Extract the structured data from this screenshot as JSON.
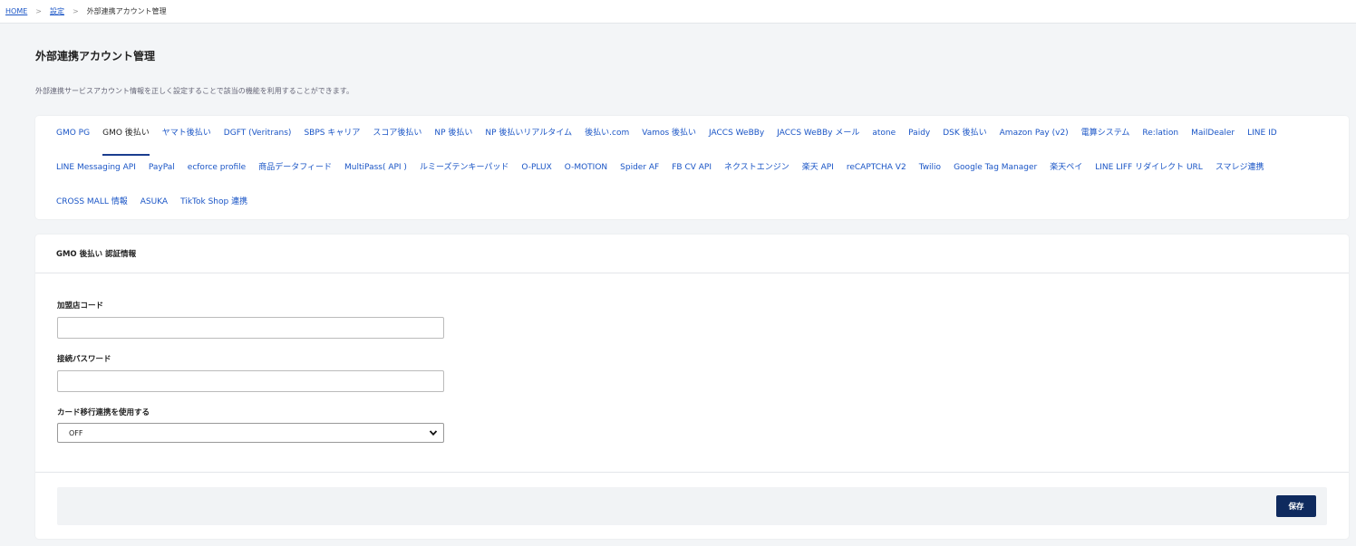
{
  "breadcrumb": {
    "home": "HOME",
    "settings": "設定",
    "current": "外部連携アカウント管理",
    "separator": ">"
  },
  "page": {
    "title": "外部連携アカウント管理",
    "description": "外部連携サービスアカウント情報を正しく設定することで該当の機能を利用することができます。"
  },
  "tabs": {
    "row1": [
      "GMO PG",
      "GMO 後払い",
      "ヤマト後払い",
      "DGFT (Veritrans)",
      "SBPS キャリア",
      "スコア後払い",
      "NP 後払い",
      "NP 後払いリアルタイム",
      "後払い.com",
      "Vamos 後払い",
      "JACCS WeBBy",
      "JACCS WeBBy メール",
      "atone",
      "Paidy",
      "DSK 後払い",
      "Amazon Pay (v2)",
      "電算システム",
      "Re:lation",
      "MailDealer",
      "LINE ID"
    ],
    "row2": [
      "LINE Messaging API",
      "PayPal",
      "ecforce profile",
      "商品データフィード",
      "MultiPass( API )",
      "ルミーズテンキーパッド",
      "O-PLUX",
      "O-MOTION",
      "Spider AF",
      "FB CV API",
      "ネクストエンジン",
      "楽天 API",
      "reCAPTCHA V2",
      "Twilio",
      "Google Tag Manager",
      "楽天ペイ",
      "LINE LIFF リダイレクト URL",
      "スマレジ連携"
    ],
    "row3": [
      "CROSS MALL 情報",
      "ASUKA",
      "TikTok Shop 連携"
    ],
    "active": "GMO 後払い"
  },
  "form": {
    "header": "GMO 後払い 認証情報",
    "shop_code_label": "加盟店コード",
    "shop_code_value": "",
    "password_label": "接続パスワード",
    "password_value": "",
    "card_migration_label": "カード移行連携を使用する",
    "card_migration_value": "OFF",
    "save_label": "保存"
  },
  "colors": {
    "link": "#1a55c6",
    "primary_button": "#0f2a5e",
    "active_tab_underline": "#1a3d8f"
  }
}
